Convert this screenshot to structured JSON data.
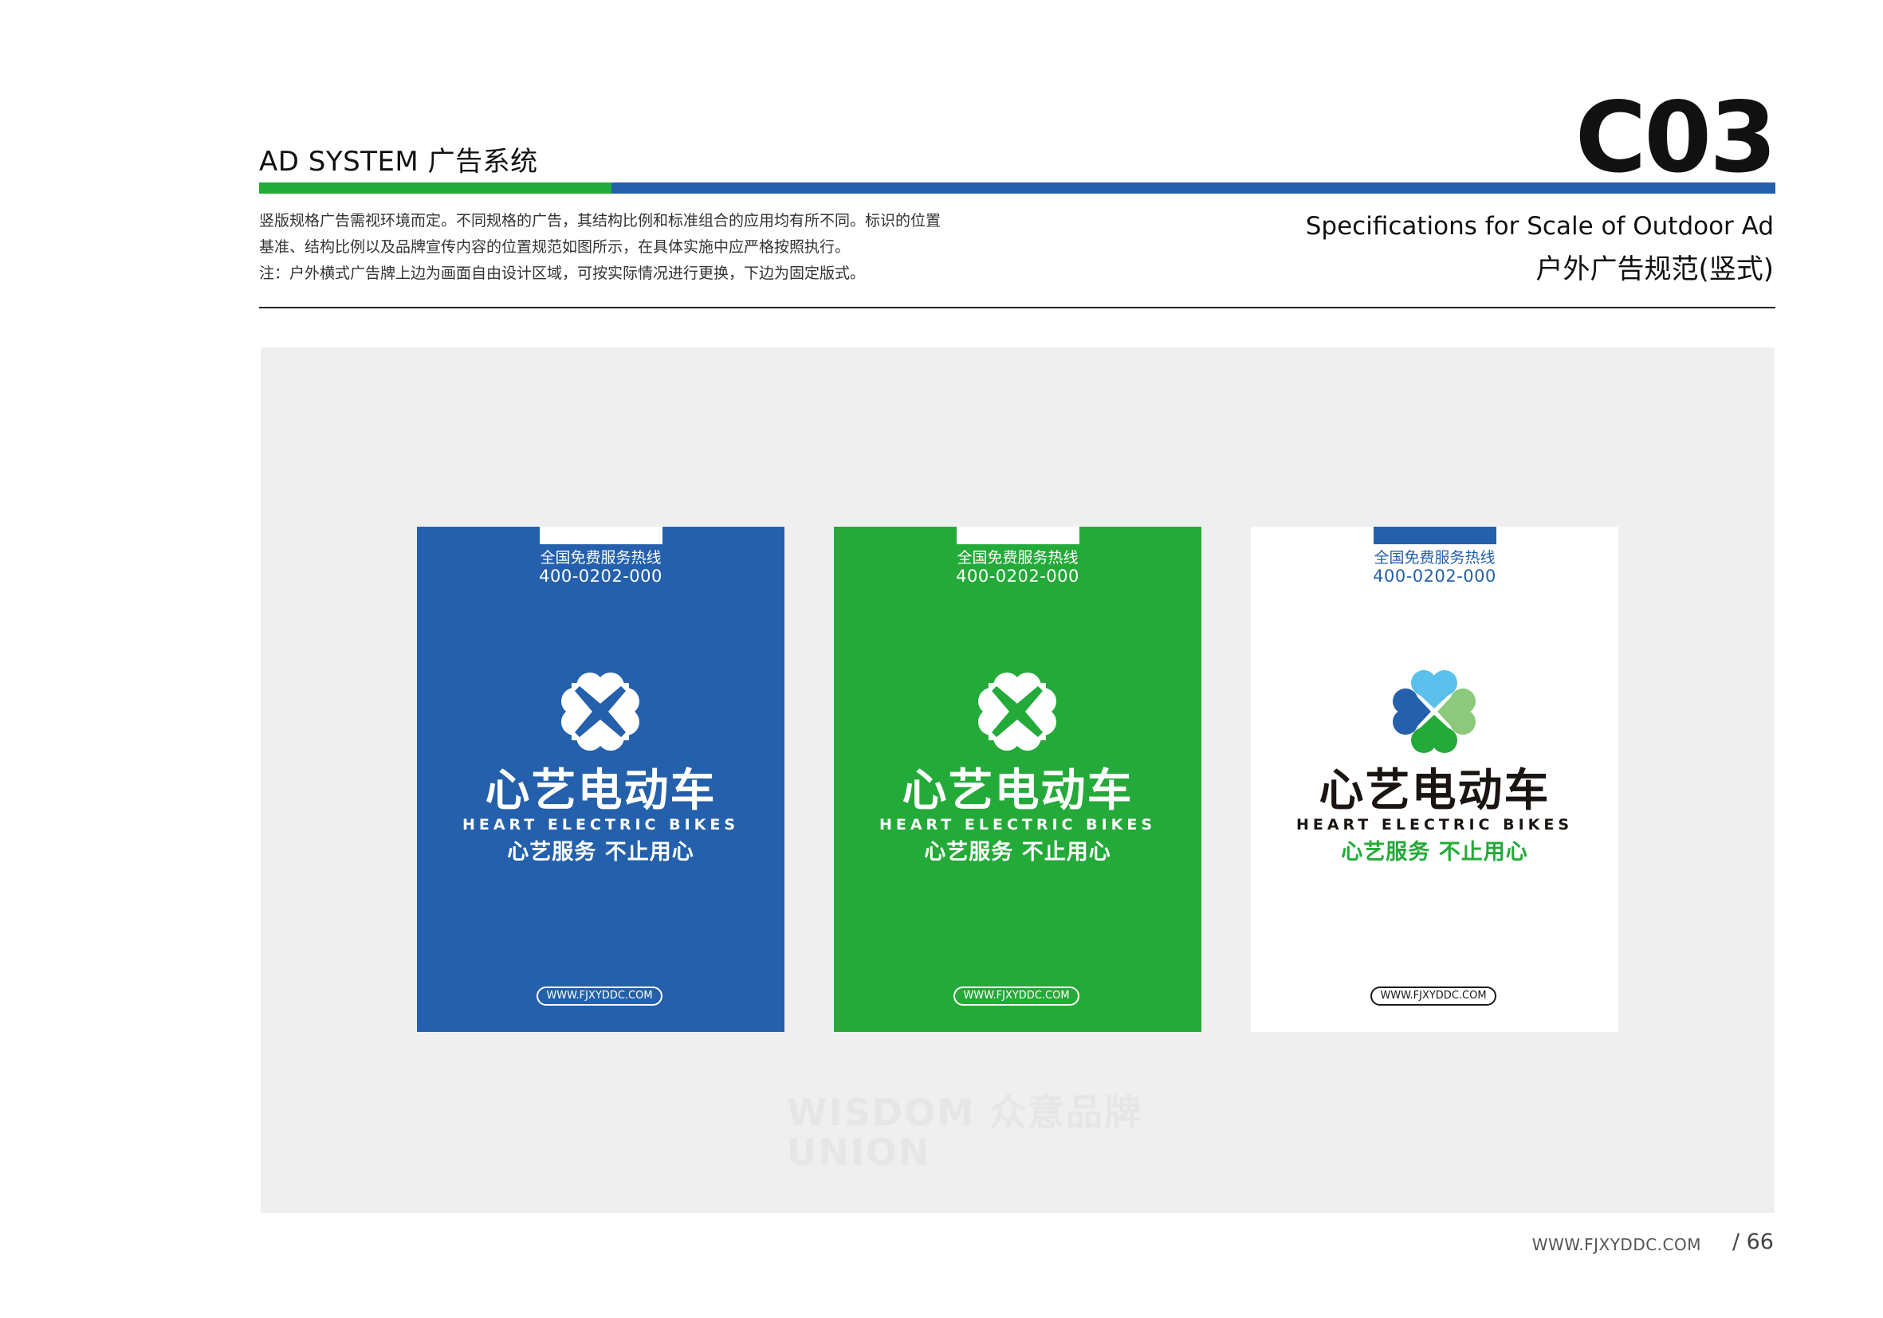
{
  "header": {
    "section_title": "AD SYSTEM 广告系统",
    "code": "C03",
    "spec_en": "Specifications for Scale of Outdoor Ad",
    "spec_cn": "户外广告规范(竖式)"
  },
  "description": [
    "竖版规格广告需视环境而定。不同规格的广告，其结构比例和标准组合的应用均有所不同。标识的位置",
    "基准、结构比例以及品牌宣传内容的位置规范如图所示，在具体实施中应严格按照执行。",
    "注：户外横式广告牌上边为画面自由设计区域，可按实际情况进行更换，下边为固定版式。"
  ],
  "colors": {
    "brand_blue": "#2460ab",
    "brand_green": "#23aa38",
    "logo_light_blue": "#5bc0eb",
    "logo_light_green": "#8cc97c",
    "stage_gray": "#eeefee"
  },
  "panels": [
    {
      "variant": "blue",
      "hotline_label": "全国免费服务热线",
      "hotline_number": "400-0202-000",
      "logo_icon": "clover-x-icon",
      "brand_cn": "心艺电动车",
      "brand_en": "HEART ELECTRIC BIKES",
      "slogan": "心艺服务 不止用心",
      "url": "WWW.FJXYDDC.COM"
    },
    {
      "variant": "green",
      "hotline_label": "全国免费服务热线",
      "hotline_number": "400-0202-000",
      "logo_icon": "clover-x-icon",
      "brand_cn": "心艺电动车",
      "brand_en": "HEART ELECTRIC BIKES",
      "slogan": "心艺服务 不止用心",
      "url": "WWW.FJXYDDC.COM"
    },
    {
      "variant": "white",
      "hotline_label": "全国免费服务热线",
      "hotline_number": "400-0202-000",
      "logo_icon": "clover-x-color-icon",
      "brand_cn": "心艺电动车",
      "brand_en": "HEART ELECTRIC BIKES",
      "slogan": "心艺服务 不止用心",
      "url": "WWW.FJXYDDC.COM"
    }
  ],
  "watermark": {
    "line1": "WISDOM 众意品牌",
    "line2": "UNION"
  },
  "footer": {
    "url": "WWW.FJXYDDC.COM",
    "page": "/ 66"
  }
}
